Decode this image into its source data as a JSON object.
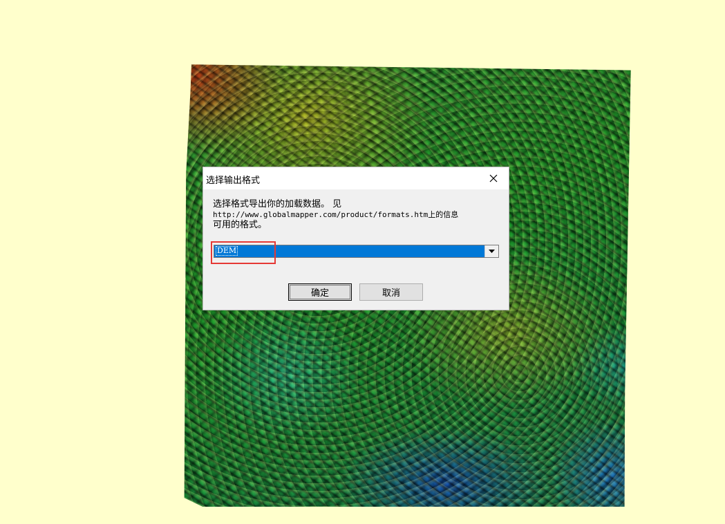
{
  "dialog": {
    "title": "选择输出格式",
    "message_lines": [
      "选择格式导出你的加载数据。 见",
      "http://www.globalmapper.com/product/formats.htm上的信息",
      "可用的格式。"
    ],
    "format_select": {
      "selected": "DEM"
    },
    "ok_label": "确定",
    "cancel_label": "取消"
  },
  "colors": {
    "background": "#ffffcc",
    "selection": "#0078d7",
    "highlight": "#e53935"
  },
  "icons": {
    "close": "close-icon",
    "dropdown": "chevron-down-icon"
  }
}
